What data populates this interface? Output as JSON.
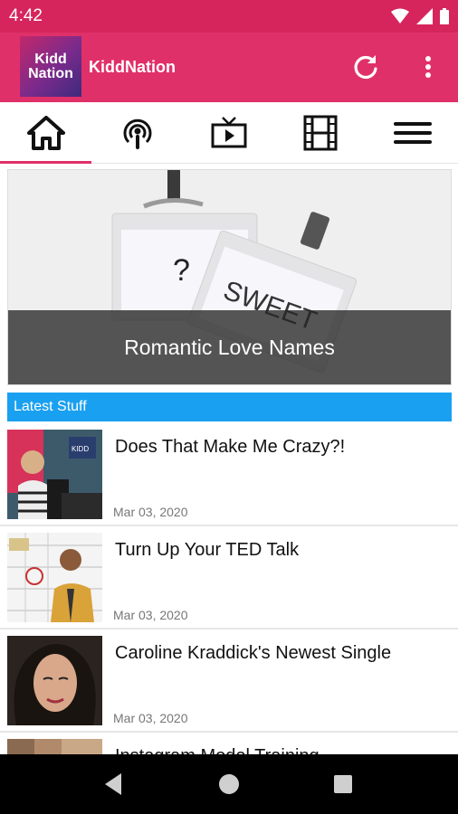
{
  "status_bar": {
    "time": "4:42"
  },
  "app_bar": {
    "logo_line1": "Kidd",
    "logo_line2": "Nation",
    "title": "KiddNation"
  },
  "tabs": [
    {
      "name": "home",
      "icon": "home-icon",
      "active": true
    },
    {
      "name": "podcast",
      "icon": "podcast-icon",
      "active": false
    },
    {
      "name": "tv",
      "icon": "tv-icon",
      "active": false
    },
    {
      "name": "film",
      "icon": "film-icon",
      "active": false
    },
    {
      "name": "menu",
      "icon": "menu-icon",
      "active": false
    }
  ],
  "hero": {
    "caption": "Romantic Love Names",
    "card_text_1": "?",
    "card_text_2": "SWEET"
  },
  "latest": {
    "header": "Latest Stuff",
    "items": [
      {
        "title": "Does That Make Me Crazy?!",
        "date": "Mar 03, 2020"
      },
      {
        "title": "Turn Up Your TED Talk",
        "date": "Mar 03, 2020"
      },
      {
        "title": "Caroline Kraddick's Newest Single",
        "date": "Mar 03, 2020"
      },
      {
        "title": "Instagram Model Training",
        "date": ""
      }
    ]
  },
  "colors": {
    "status_bar": "#d6255c",
    "app_bar": "#e0306a",
    "section_header": "#1aa0f0",
    "nav_bar": "#000000"
  }
}
